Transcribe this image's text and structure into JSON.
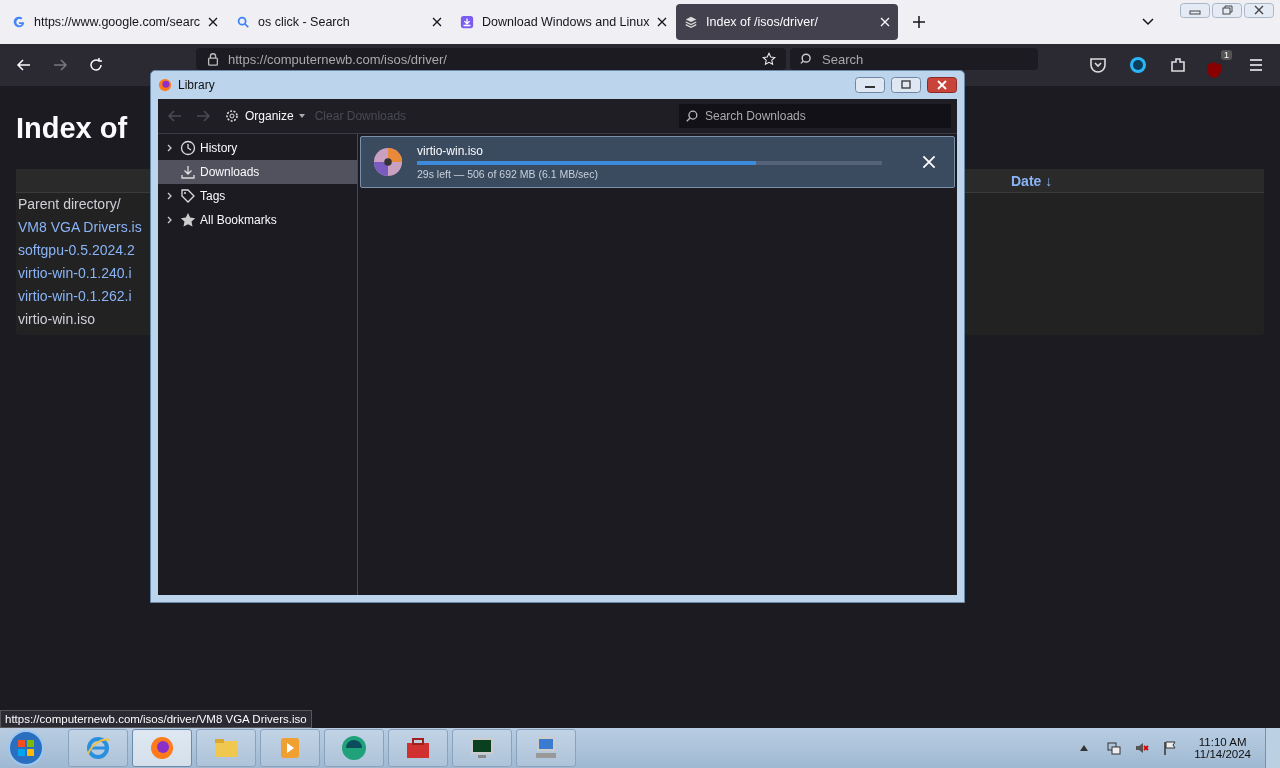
{
  "tabs": [
    {
      "label": "https://www.google.com/searc",
      "selected": false
    },
    {
      "label": "os click - Search",
      "selected": false
    },
    {
      "label": "Download Windows and Linux",
      "selected": false
    },
    {
      "label": "Index of /isos/driver/",
      "selected": true
    }
  ],
  "toolbar": {
    "url": "https://computernewb.com/isos/driver/",
    "search_placeholder": "Search",
    "extension_badge": "1"
  },
  "page": {
    "heading": "Index of",
    "date_column": "Date ↓",
    "links": [
      {
        "label": "Parent directory/",
        "visited": false
      },
      {
        "label": "VM8 VGA Drivers.is",
        "visited": true
      },
      {
        "label": "softgpu-0.5.2024.2",
        "visited": true
      },
      {
        "label": "virtio-win-0.1.240.i",
        "visited": true
      },
      {
        "label": "virtio-win-0.1.262.i",
        "visited": true
      },
      {
        "label": "virtio-win.iso",
        "visited": false
      }
    ]
  },
  "library": {
    "title": "Library",
    "organize": "Organize",
    "clear_downloads": "Clear Downloads",
    "clear_disabled": true,
    "search_placeholder": "Search Downloads",
    "sidebar": [
      {
        "label": "History",
        "expandable": true,
        "selected": false
      },
      {
        "label": "Downloads",
        "expandable": false,
        "selected": true
      },
      {
        "label": "Tags",
        "expandable": true,
        "selected": false
      },
      {
        "label": "All Bookmarks",
        "expandable": true,
        "selected": false
      }
    ],
    "downloads": [
      {
        "name": "virtio-win.iso",
        "level": 0.73,
        "status": "29s left — 506 of 692 MB (6.1 MB/sec)"
      }
    ]
  },
  "status_url": "https://computernewb.com/isos/driver/VM8 VGA Drivers.iso",
  "taskbar": {
    "apps": [
      {
        "active": false
      },
      {
        "active": true
      },
      {
        "active": false
      },
      {
        "active": false
      },
      {
        "active": false
      },
      {
        "active": false
      },
      {
        "active": false
      },
      {
        "active": false
      }
    ],
    "time": "11:10 AM",
    "date": "11/14/2024"
  }
}
